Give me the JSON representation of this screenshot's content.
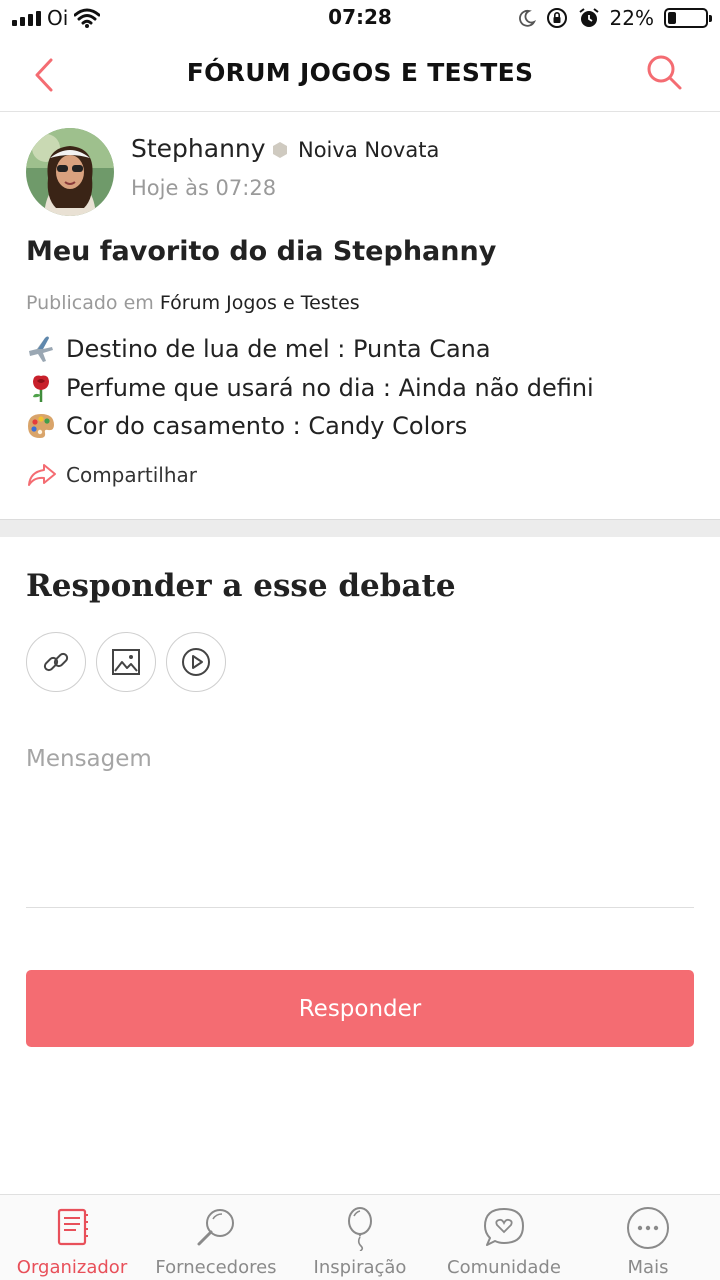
{
  "status_bar": {
    "carrier": "Oi",
    "time": "07:28",
    "battery": "22%",
    "battery_level": 0.22
  },
  "header": {
    "title": "FÓRUM JOGOS E TESTES"
  },
  "post": {
    "author": "Stephanny",
    "level": "Noiva Novata",
    "time": "Hoje às 07:28",
    "title": "Meu favorito do dia Stephanny",
    "published_prefix": "Publicado em",
    "published_forum": "Fórum Jogos e Testes",
    "lines": [
      {
        "icon": "airplane-emoji",
        "text": "Destino de lua de mel : Punta Cana"
      },
      {
        "icon": "rose-emoji",
        "text": "Perfume que usará no dia : Ainda não defini"
      },
      {
        "icon": "palette-emoji",
        "text": "Cor do casamento : Candy Colors"
      }
    ],
    "share_label": "Compartilhar"
  },
  "reply": {
    "title": "Responder a esse debate",
    "message_placeholder": "Mensagem",
    "message_value": "",
    "submit_label": "Responder"
  },
  "tabs": [
    {
      "label": "Organizador",
      "icon": "planner-icon",
      "active": true
    },
    {
      "label": "Fornecedores",
      "icon": "magnifier-icon",
      "active": false
    },
    {
      "label": "Inspiração",
      "icon": "balloon-icon",
      "active": false
    },
    {
      "label": "Comunidade",
      "icon": "chat-heart-icon",
      "active": false
    },
    {
      "label": "Mais",
      "icon": "more-icon",
      "active": false
    }
  ],
  "colors": {
    "accent": "#f46c72",
    "accent_text": "#e8505a",
    "muted": "#9a9a9a"
  }
}
